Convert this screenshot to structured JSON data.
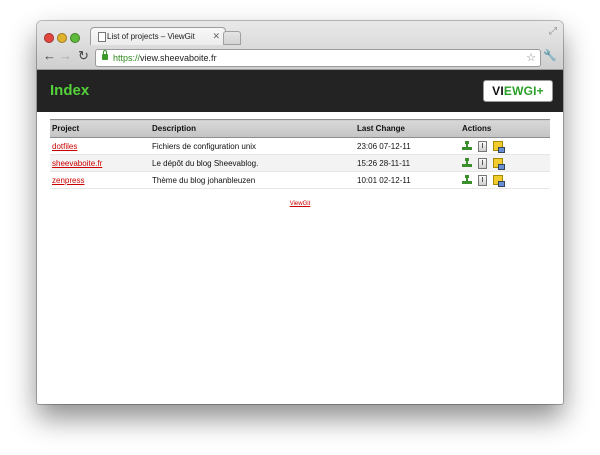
{
  "browser": {
    "tab_title": "List of projects – ViewGit",
    "tab_close": "✕",
    "url_scheme": "https://",
    "url_host": "view.sheevaboite.fr",
    "back": "←",
    "forward": "→",
    "reload": "↻",
    "star": "☆",
    "wrench": "🔧"
  },
  "header": {
    "index_label": "Index",
    "logo_text_1": "VI",
    "logo_text_2": "EWGI",
    "logo_text_3": "+"
  },
  "table": {
    "columns": [
      "Project",
      "Description",
      "Last Change",
      "Actions"
    ],
    "rows": [
      {
        "project": "dotfiles",
        "description": "Fichiers de configuration unix",
        "last_change": "23:06 07-12-11"
      },
      {
        "project": "sheevaboite.fr",
        "description": "Le dépôt du blog Sheevablog.",
        "last_change": "15:26 28-11-11"
      },
      {
        "project": "zenpress",
        "description": "Thème du blog johanbleuzen",
        "last_change": "10:01 02-12-11"
      }
    ]
  },
  "footer": {
    "link": "ViewGit"
  },
  "colors": {
    "header_bg": "#232323",
    "index_green": "#54d13a",
    "link_red": "#cc0000"
  }
}
